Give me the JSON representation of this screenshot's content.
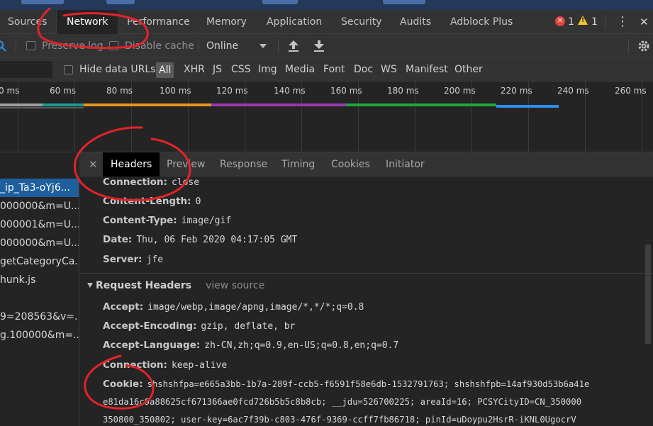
{
  "devtools": {
    "tabs": [
      "Sources",
      "Network",
      "Performance",
      "Memory",
      "Application",
      "Security",
      "Audits",
      "Adblock Plus"
    ],
    "active_tab": "Network",
    "error_count": "1",
    "warning_count": "1",
    "warning_glyph": "!",
    "menu_glyph": "⋮",
    "close_glyph": "✕"
  },
  "toolbar": {
    "preserve_log": "Preserve log",
    "disable_cache": "Disable cache",
    "throttle": "Online"
  },
  "filter": {
    "hide_data_urls": "Hide data URLs",
    "types": [
      "All",
      "XHR",
      "JS",
      "CSS",
      "Img",
      "Media",
      "Font",
      "Doc",
      "WS",
      "Manifest",
      "Other"
    ],
    "active_type": "All"
  },
  "timeline": {
    "ticks": [
      "0 ms",
      "60 ms",
      "80 ms",
      "100 ms",
      "120 ms",
      "140 ms",
      "160 ms",
      "180 ms",
      "200 ms",
      "220 ms",
      "240 ms",
      "260 ms"
    ],
    "colors": {
      "gray": "#9e9e9e",
      "teal": "#179e8f",
      "orange": "#e8961c",
      "purple": "#9b38b0",
      "green": "#20a83a",
      "blue": "#2f8ee8"
    }
  },
  "requests": [
    "_ip_Ta3-oYj6...",
    "000000&m=U...",
    "000001&m=U...",
    "000000&m=U...",
    "getCategoryCa...",
    "hunk.js",
    "",
    "9=208563&v=...",
    "g.100000&m=..."
  ],
  "details": {
    "tabs": [
      "Headers",
      "Preview",
      "Response",
      "Timing",
      "Cookies",
      "Initiator"
    ],
    "active_tab": "Headers",
    "response_headers": [
      {
        "name": "Connection:",
        "value": "close"
      },
      {
        "name": "Content-Length:",
        "value": "0"
      },
      {
        "name": "Content-Type:",
        "value": "image/gif"
      },
      {
        "name": "Date:",
        "value": "Thu, 06 Feb 2020 04:17:05 GMT"
      },
      {
        "name": "Server:",
        "value": "jfe"
      }
    ],
    "request_section_title": "Request Headers",
    "view_source": "view source",
    "request_headers": [
      {
        "name": "Accept:",
        "value": "image/webp,image/apng,image/*,*/*;q=0.8"
      },
      {
        "name": "Accept-Encoding:",
        "value": "gzip, deflate, br"
      },
      {
        "name": "Accept-Language:",
        "value": "zh-CN,zh;q=0.9,en-US;q=0.8,en;q=0.7"
      },
      {
        "name": "Connection:",
        "value": "keep-alive"
      },
      {
        "name": "Cookie:",
        "value": "shshshfpa=e665a3bb-1b7a-289f-ccb5-f6591f58e6db-1532791763; shshshfpb=14af930d53b6a41e"
      }
    ],
    "cookie_continuation": [
      "e81da16c9a88625cf671366ae0fcd726b5b5c8b8cb; __jdu=526700225; areaId=16; PCSYCityID=CN_350000",
      " 350800_350802; user-key=6ac7f39b-c803-476f-9369-ccff7fb86718; pinId=uDoypu2HsrR-iKNL0UgocrV"
    ]
  },
  "annotation_color": "#e3232b"
}
